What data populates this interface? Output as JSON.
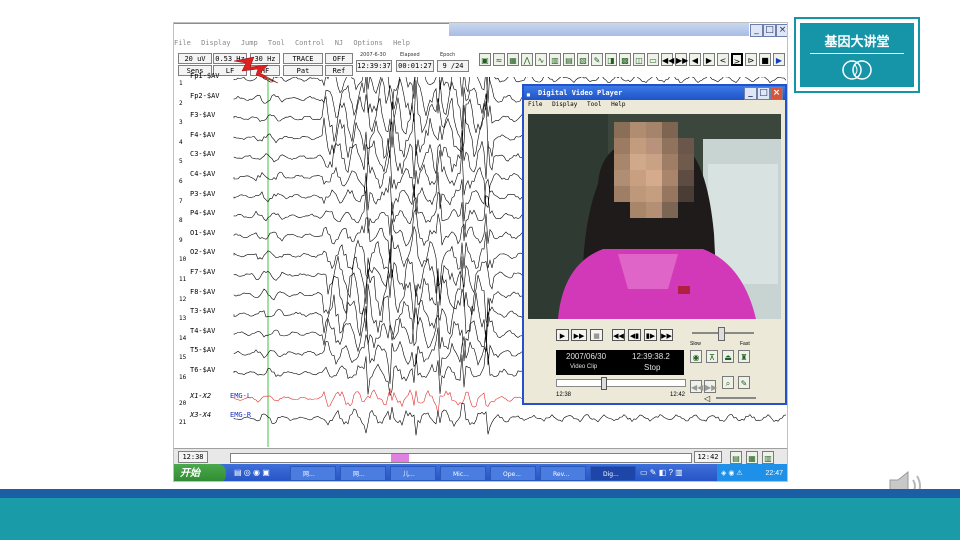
{
  "app": {
    "menu": [
      "File",
      "Display",
      "Jump",
      "Tool",
      "Control",
      "NJ",
      "Options",
      "Help"
    ]
  },
  "toolbar": {
    "sens": "20 uV",
    "lf_val": "0.53 Hz",
    "hf_val": "30 Hz",
    "trace": "TRACE",
    "off": "OFF",
    "date_small": "2007-6-30",
    "time": "12:39:37",
    "elapsed_label": "Elapsed",
    "elapsed": "00:01:27",
    "epoch_label": "Epoch",
    "epoch": "9 /24",
    "sens_btn": "Sens",
    "lf_btn": "LF",
    "hf_btn": "HF",
    "pat_btn": "Pat",
    "ref_btn": "Ref"
  },
  "channels": [
    {
      "num": "1",
      "label": "Fp1-$AV"
    },
    {
      "num": "2",
      "label": "Fp2-$AV"
    },
    {
      "num": "3",
      "label": "F3-$AV"
    },
    {
      "num": "4",
      "label": "F4-$AV"
    },
    {
      "num": "5",
      "label": "C3-$AV"
    },
    {
      "num": "6",
      "label": "C4-$AV"
    },
    {
      "num": "7",
      "label": "P3-$AV"
    },
    {
      "num": "8",
      "label": "P4-$AV"
    },
    {
      "num": "9",
      "label": "O1-$AV"
    },
    {
      "num": "10",
      "label": "O2-$AV"
    },
    {
      "num": "11",
      "label": "F7-$AV"
    },
    {
      "num": "12",
      "label": "F8-$AV"
    },
    {
      "num": "13",
      "label": "T3-$AV"
    },
    {
      "num": "14",
      "label": "T4-$AV"
    },
    {
      "num": "15",
      "label": "T5-$AV"
    },
    {
      "num": "16",
      "label": "T6-$AV"
    },
    {
      "num": "20",
      "label": "X1-X2",
      "tag": "EMG-L"
    },
    {
      "num": "21",
      "label": "X3-X4",
      "tag": "EMG-R"
    }
  ],
  "bottom": {
    "start_time": "12:38",
    "end_time": "12:42"
  },
  "video_player": {
    "title": "Digital Video Player",
    "menu": [
      "File",
      "Display",
      "Tool",
      "Help"
    ],
    "slow": "Slow",
    "fast": "Fast",
    "date": "2007/06/30",
    "time": "12:39:38.2",
    "clip_label": "Video Clip",
    "state": "Stop",
    "range_start": "12:38",
    "range_end": "12:42"
  },
  "taskbar": {
    "start": "开始",
    "tasks": [
      "网...",
      "网...",
      "儿...",
      "Mic...",
      "Ope...",
      "Rev...",
      "Dig..."
    ],
    "clock": "22:47"
  },
  "logo": {
    "text": "基因大讲堂",
    "brand_color": "#1694a8"
  }
}
